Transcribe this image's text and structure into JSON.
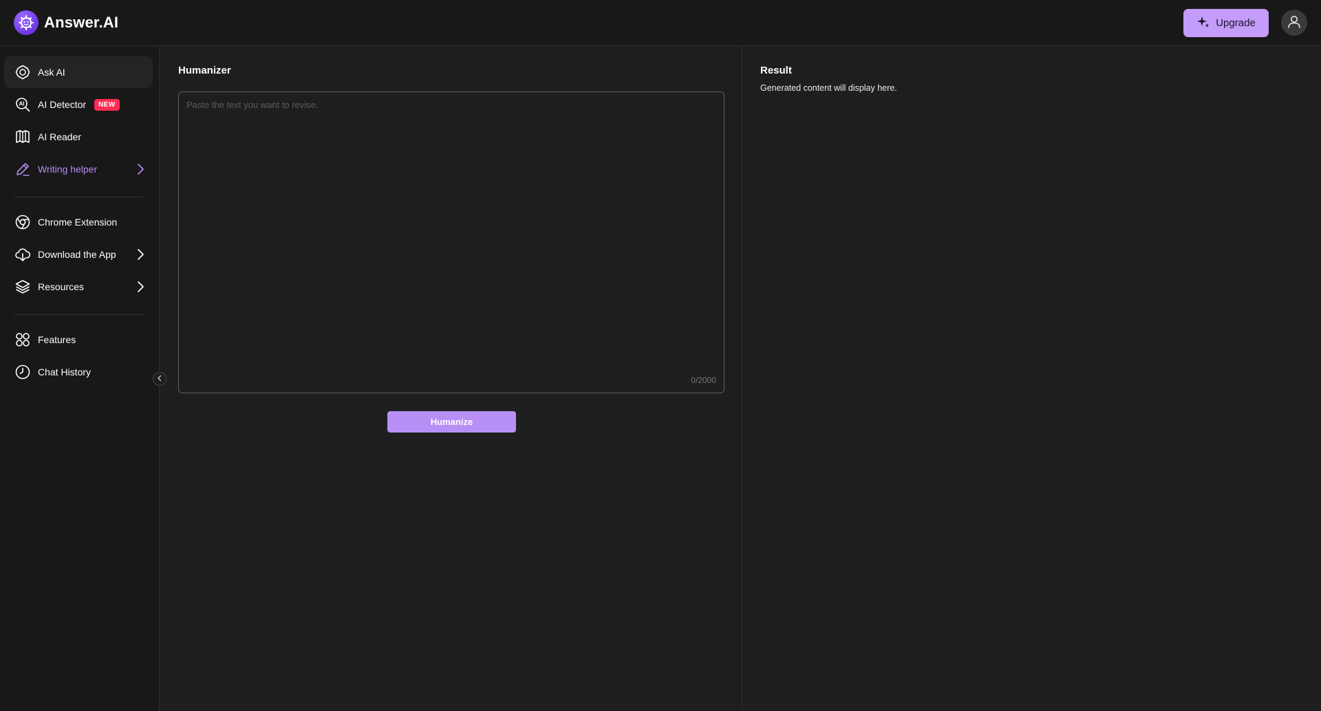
{
  "header": {
    "app_name": "Answer.AI",
    "upgrade_label": "Upgrade"
  },
  "sidebar": {
    "items": [
      {
        "label": "Ask AI",
        "icon": "ask-ai-icon"
      },
      {
        "label": "AI Detector",
        "icon": "ai-detector-icon",
        "badge": "NEW"
      },
      {
        "label": "AI Reader",
        "icon": "book-icon"
      },
      {
        "label": "Writing helper",
        "icon": "pen-icon"
      },
      {
        "label": "Chrome Extension",
        "icon": "chrome-icon"
      },
      {
        "label": "Download the App",
        "icon": "cloud-download-icon"
      },
      {
        "label": "Resources",
        "icon": "layers-icon"
      },
      {
        "label": "Features",
        "icon": "grid-icon"
      },
      {
        "label": "Chat History",
        "icon": "clock-icon"
      }
    ]
  },
  "humanizer": {
    "title": "Humanizer",
    "placeholder": "Paste the text you want to revise.",
    "value": "",
    "counter": "0/2000",
    "button_label": "Humanize"
  },
  "result": {
    "title": "Result",
    "subtitle": "Generated content will display here."
  },
  "colors": {
    "accent": "#b890f5",
    "upgrade_bg": "#c49cf9",
    "badge_red": "#ff2d55",
    "background": "#1e1e1e",
    "sidebar_bg": "#181818"
  }
}
